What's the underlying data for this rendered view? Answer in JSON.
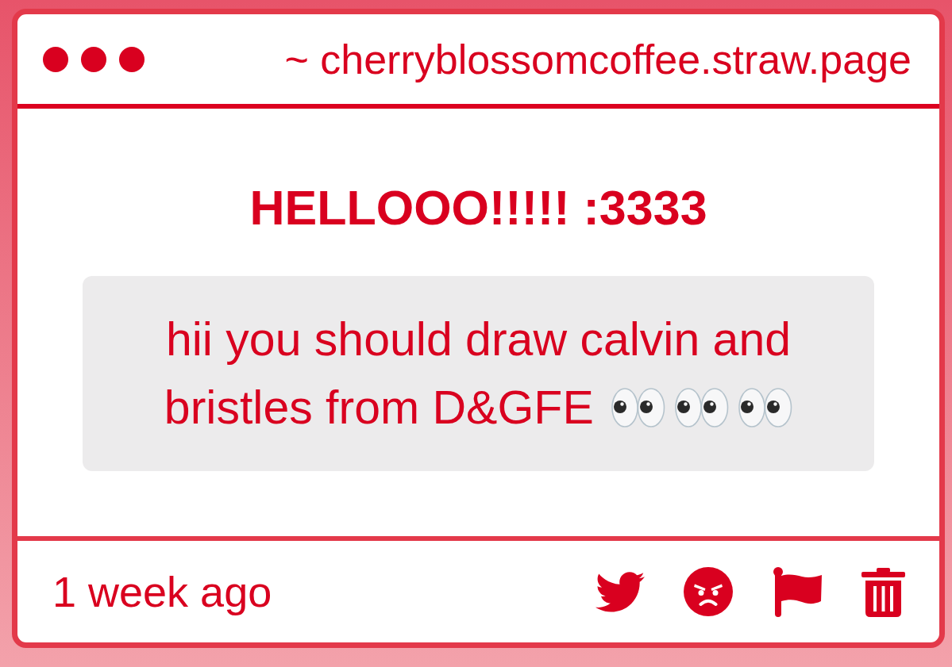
{
  "window": {
    "url": "~ cherryblossomcoffee.straw.page"
  },
  "post": {
    "title": "HELLOOO!!!!! :3333",
    "message": "hii you should draw calvin and bristles from D&GFE"
  },
  "footer": {
    "time": "1 week ago"
  }
}
